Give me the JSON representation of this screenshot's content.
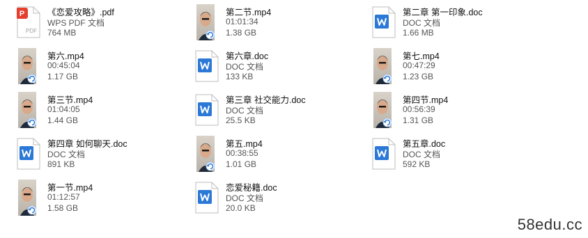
{
  "files": [
    {
      "name": "《恋爱攻略》.pdf",
      "sub": "WPS PDF 文档",
      "size": "764 MB",
      "type": "pdf"
    },
    {
      "name": "第二节.mp4",
      "sub": "01:01:34",
      "size": "1.38 GB",
      "type": "video"
    },
    {
      "name": "第二章 第一印象.doc",
      "sub": "DOC 文档",
      "size": "1.66 MB",
      "type": "doc"
    },
    {
      "name": "第六.mp4",
      "sub": "00:45:04",
      "size": "1.17 GB",
      "type": "video"
    },
    {
      "name": "第六章.doc",
      "sub": "DOC 文档",
      "size": "133 KB",
      "type": "doc"
    },
    {
      "name": "第七.mp4",
      "sub": "00:47:29",
      "size": "1.23 GB",
      "type": "video"
    },
    {
      "name": "第三节.mp4",
      "sub": "01:04:05",
      "size": "1.44 GB",
      "type": "video"
    },
    {
      "name": "第三章 社交能力.doc",
      "sub": "DOC 文档",
      "size": "25.5 KB",
      "type": "doc"
    },
    {
      "name": "第四节.mp4",
      "sub": "00:56:39",
      "size": "1.31 GB",
      "type": "video"
    },
    {
      "name": "第四章 如何聊天.doc",
      "sub": "DOC 文档",
      "size": "891 KB",
      "type": "doc"
    },
    {
      "name": "第五.mp4",
      "sub": "00:38:55",
      "size": "1.01 GB",
      "type": "video"
    },
    {
      "name": "第五章.doc",
      "sub": "DOC 文档",
      "size": "592 KB",
      "type": "doc"
    },
    {
      "name": "第一节.mp4",
      "sub": "01:12:57",
      "size": "1.58 GB",
      "type": "video"
    },
    {
      "name": "恋爱秘籍.doc",
      "sub": "DOC 文档",
      "size": "20.0 KB",
      "type": "doc"
    }
  ],
  "pdf_badge_text": "PDF",
  "doc_badge_letter": "W",
  "watermark": "58edu.cc",
  "colors": {
    "accent_blue": "#2b78d6",
    "pdf_red": "#e5402f"
  }
}
